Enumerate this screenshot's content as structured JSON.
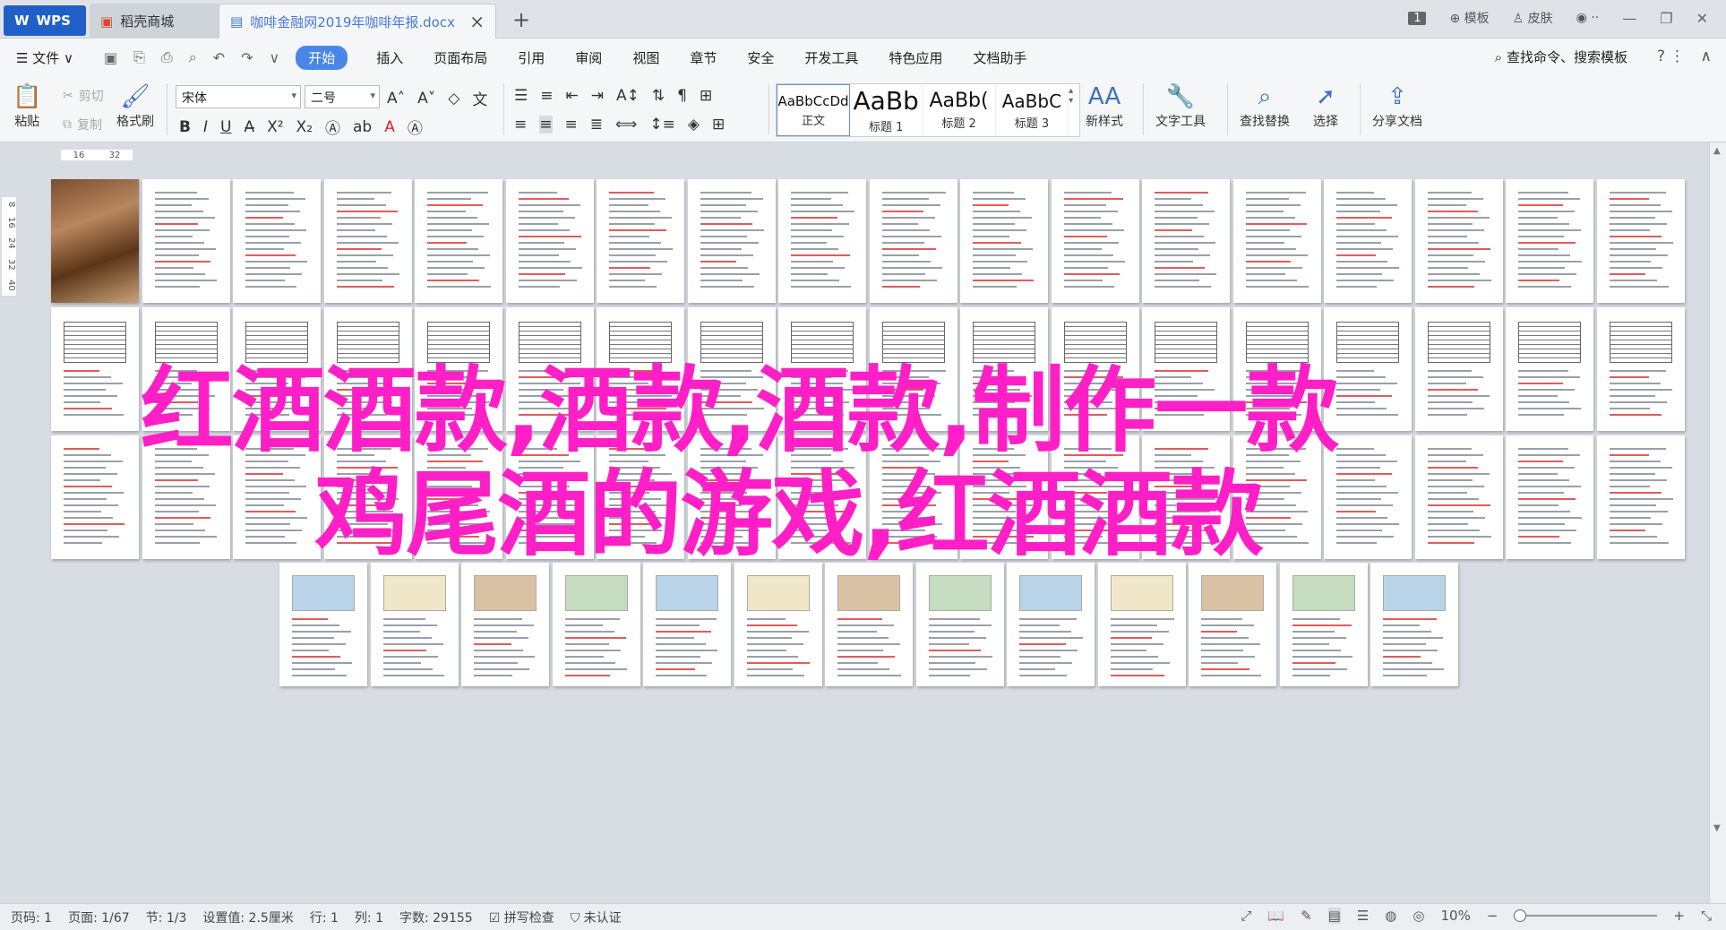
{
  "tabs": {
    "wps": "WPS",
    "store": "稻壳商城",
    "doc": "咖啡金融网2019年咖啡年报.docx",
    "badge": "1",
    "template": "模板",
    "skin": "皮肤"
  },
  "menu": {
    "file": "文件",
    "start": "开始",
    "items": [
      "插入",
      "页面布局",
      "引用",
      "审阅",
      "视图",
      "章节",
      "安全",
      "开发工具",
      "特色应用",
      "文档助手"
    ],
    "search": "查找命令、搜索模板"
  },
  "ribbon": {
    "paste": "粘贴",
    "cut": "剪切",
    "copy": "复制",
    "format_painter": "格式刷",
    "font": "宋体",
    "size": "二号",
    "styles": [
      {
        "preview": "AaBbCcDd",
        "label": "正文"
      },
      {
        "preview": "AaBb",
        "label": "标题 1"
      },
      {
        "preview": "AaBb(",
        "label": "标题 2"
      },
      {
        "preview": "AaBbC",
        "label": "标题 3"
      }
    ],
    "new_style": "新样式",
    "text_tools": "文字工具",
    "find_replace": "查找替换",
    "select": "选择",
    "share": "分享文档"
  },
  "ruler": {
    "h1": "16",
    "h2": "32",
    "v": [
      "8",
      "16",
      "24",
      "32",
      "40"
    ]
  },
  "overlay": {
    "line1": "红酒酒款,酒款,酒款,制作一款",
    "line2": "鸡尾酒的游戏,红酒酒款"
  },
  "status": {
    "page_no": "页码: 1",
    "pages": "页面: 1/67",
    "section": "节: 1/3",
    "setting": "设置值: 2.5厘米",
    "row": "行: 1",
    "col": "列: 1",
    "words": "字数: 29155",
    "spell": "拼写检查",
    "cert": "未认证",
    "zoom": "10%"
  },
  "colors": {
    "accent": "#4a86e8",
    "overlay": "#ff1fc6",
    "wps": "#1f5fc7"
  }
}
